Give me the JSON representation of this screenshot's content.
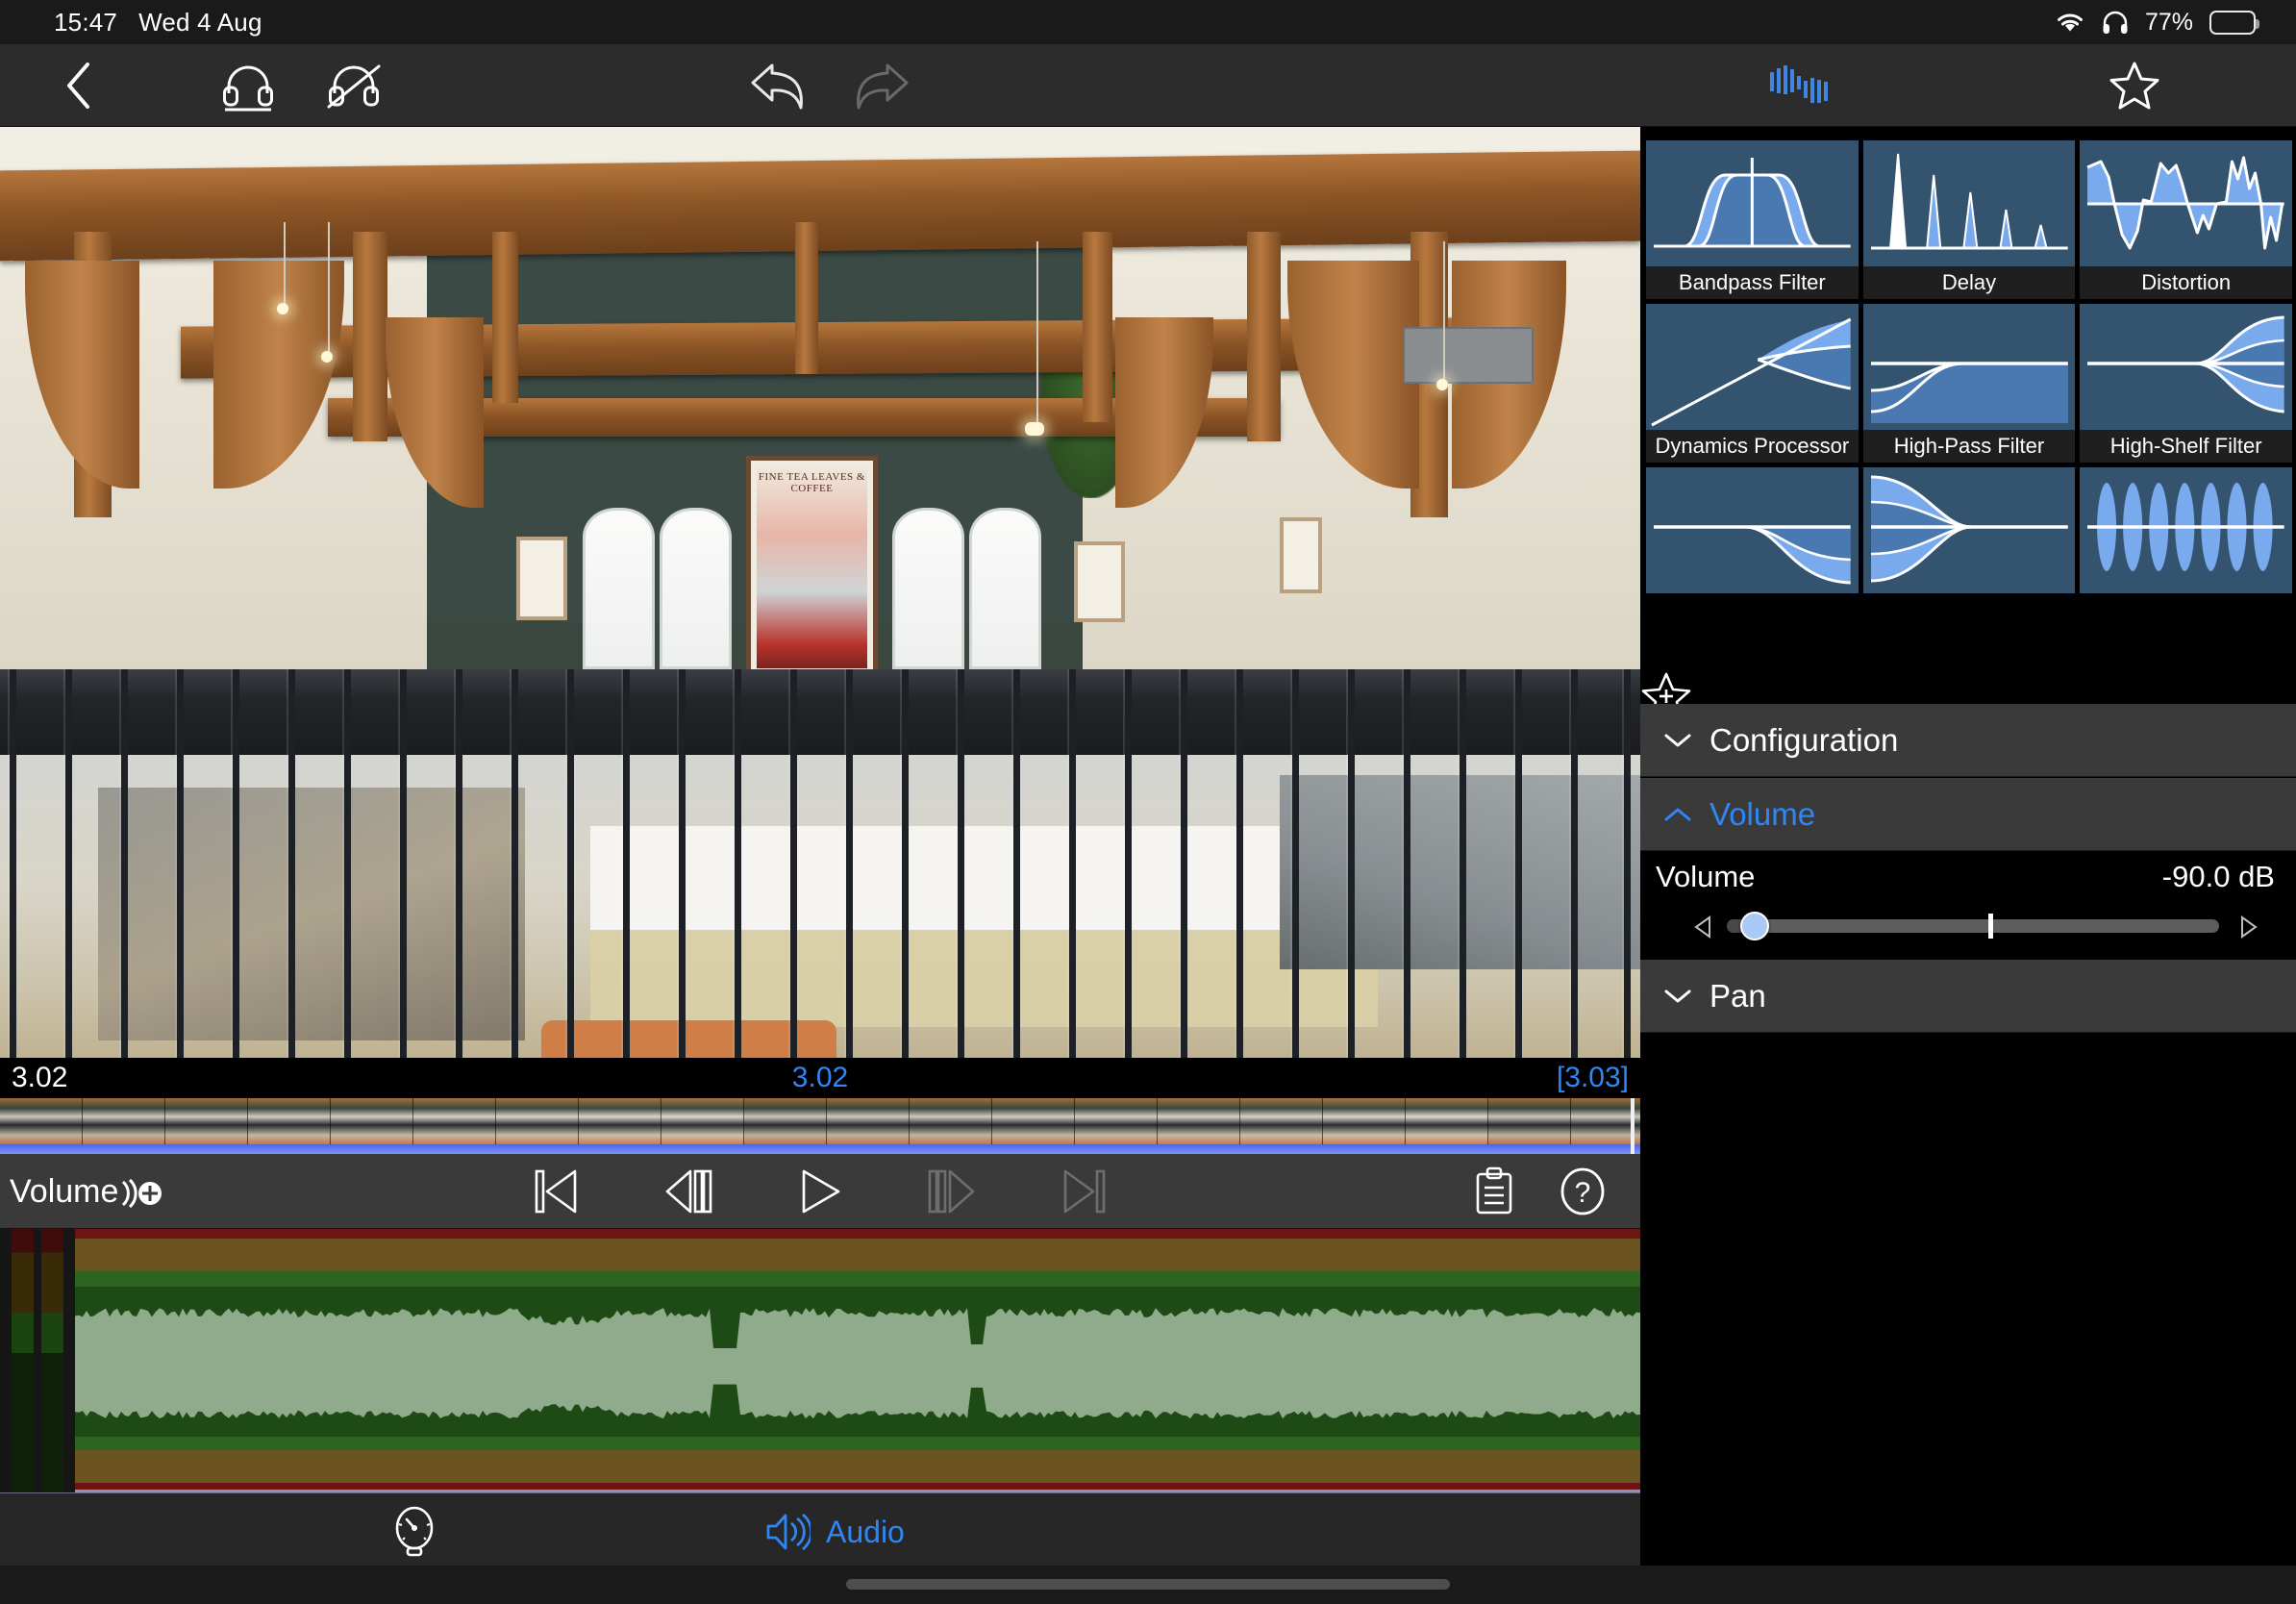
{
  "status_bar": {
    "time": "15:47",
    "date": "Wed 4 Aug",
    "battery_percent": "77%",
    "icons": [
      "wifi-icon",
      "headphones-icon",
      "battery-icon"
    ]
  },
  "toolbar": {
    "back_icon": "chevron-left-icon",
    "monitor_icon": "headphones-monitor-icon",
    "monitor_off_icon": "headphones-muted-icon",
    "undo_icon": "undo-arrow-icon",
    "redo_icon": "redo-arrow-icon",
    "effects_icon": "audio-waveform-icon",
    "favorite_icon": "star-outline-icon"
  },
  "preview": {
    "description": "video-preview-frame"
  },
  "timecode": {
    "left": "3.02",
    "center": "3.02",
    "right": "[3.03]"
  },
  "transport": {
    "lane_label": "Volume",
    "add_keyframe_icon": "add-automation-point-icon",
    "buttons": [
      {
        "name": "skip-to-start-button",
        "icon": "skip-start-icon",
        "enabled": true
      },
      {
        "name": "step-backward-button",
        "icon": "step-back-icon",
        "enabled": true
      },
      {
        "name": "play-button",
        "icon": "play-icon",
        "enabled": true
      },
      {
        "name": "step-forward-button",
        "icon": "step-forward-icon",
        "enabled": false
      },
      {
        "name": "skip-to-end-button",
        "icon": "skip-end-icon",
        "enabled": false
      }
    ],
    "clipboard_icon": "clipboard-list-icon",
    "help_icon": "help-question-icon"
  },
  "bottom_bar": {
    "speed_icon": "speedometer-icon",
    "audio_label": "Audio",
    "audio_icon": "speaker-waves-icon"
  },
  "inspector": {
    "effects": [
      {
        "label": "Bandpass Filter",
        "art": "bandpass",
        "has_label": true
      },
      {
        "label": "Delay",
        "art": "delay",
        "has_label": true
      },
      {
        "label": "Distortion",
        "art": "distortion",
        "has_label": true
      },
      {
        "label": "Dynamics Processor",
        "art": "dynamics",
        "has_label": true
      },
      {
        "label": "High-Pass Filter",
        "art": "highpass",
        "has_label": true
      },
      {
        "label": "High-Shelf Filter",
        "art": "highshelf",
        "has_label": true
      },
      {
        "label": "",
        "art": "lowshelf",
        "has_label": false
      },
      {
        "label": "",
        "art": "lowpass",
        "has_label": false
      },
      {
        "label": "",
        "art": "tremolo",
        "has_label": false
      }
    ],
    "add_favorite_icon": "star-plus-icon",
    "sections": [
      {
        "title": "Configuration",
        "expanded": false,
        "chevron": "chevron-down-icon"
      },
      {
        "title": "Volume",
        "expanded": true,
        "chevron": "chevron-up-icon"
      },
      {
        "title": "Pan",
        "expanded": false,
        "chevron": "chevron-down-icon"
      }
    ],
    "volume_control": {
      "name": "Volume",
      "value": "-90.0 dB",
      "decrement_icon": "triangle-left-icon",
      "increment_icon": "triangle-right-icon"
    }
  },
  "colors": {
    "accent_blue": "#2f86f7",
    "tile_bg": "#33536f",
    "tile_curve_light": "#7aaaee",
    "tile_curve_mid": "#4a78b0",
    "toolbar_bg": "#2c2c2c",
    "panel_bg": "#000000",
    "section_bg": "#3a3a3a",
    "waveform_green": "#8fab8b",
    "playhead_blue": "#4a66e8"
  }
}
